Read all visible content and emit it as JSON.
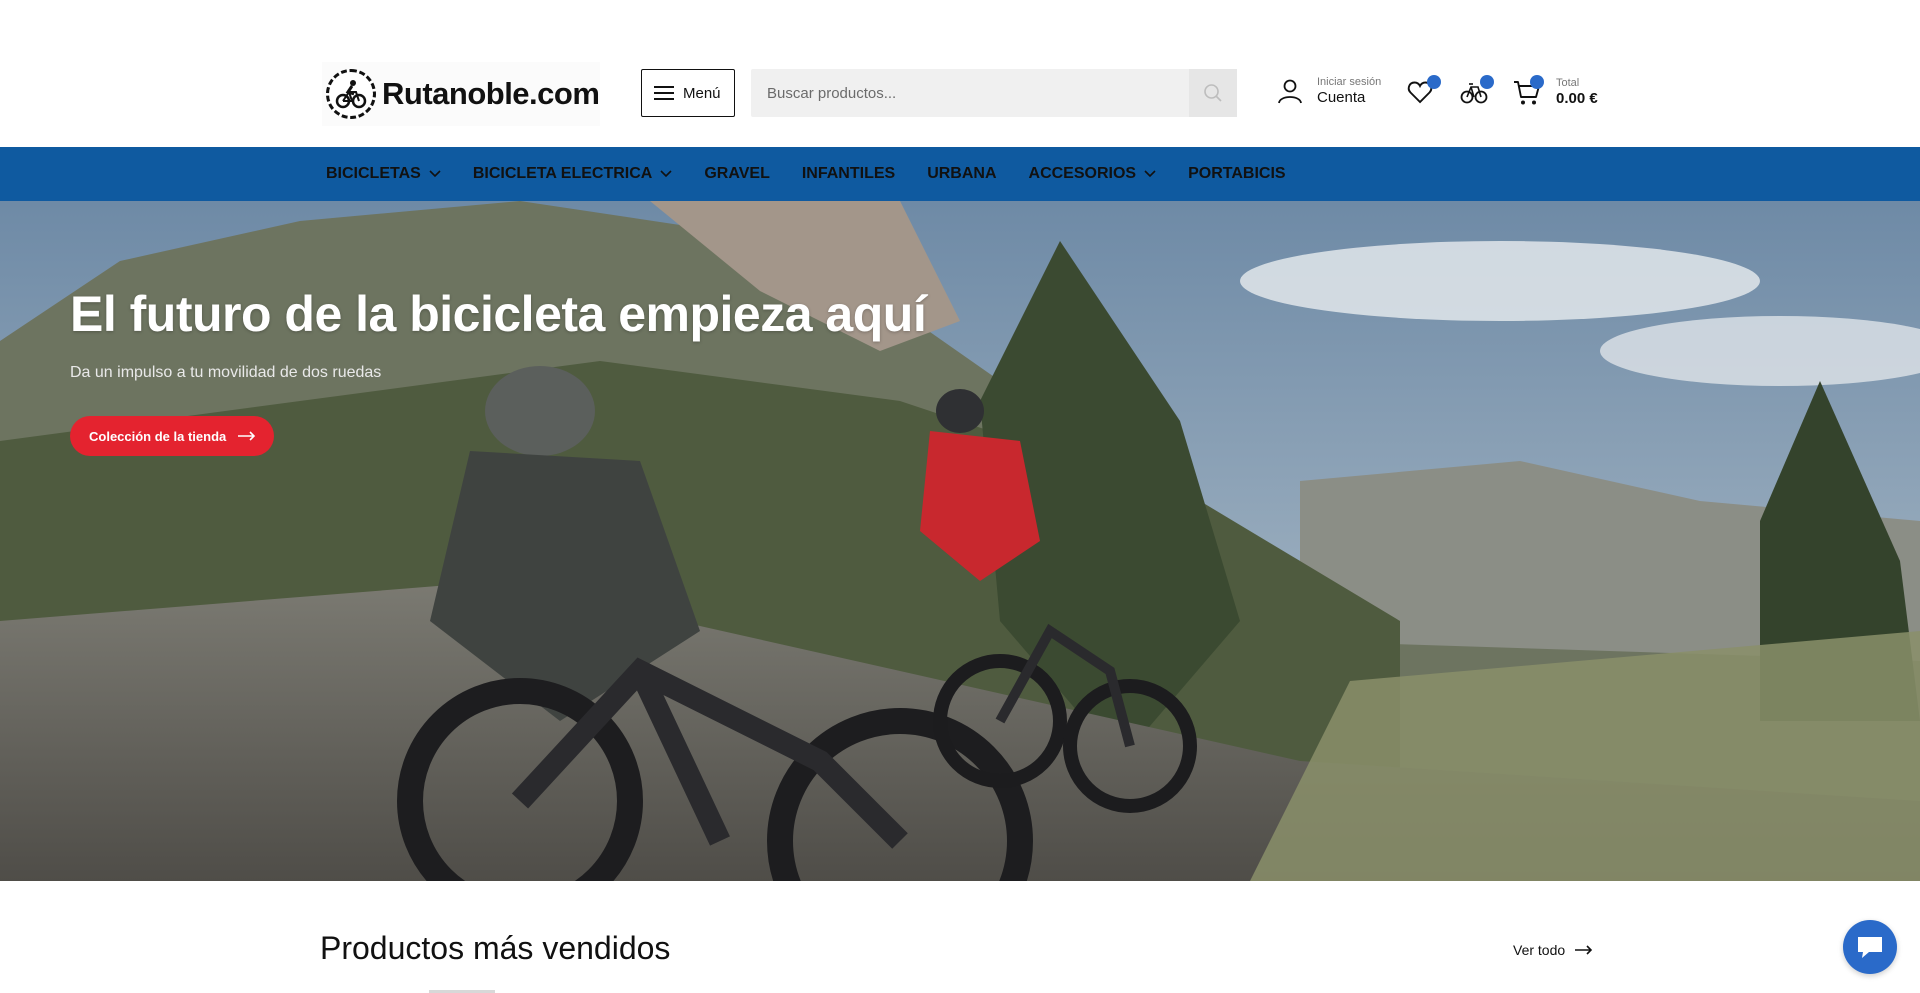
{
  "header": {
    "logo_text": "Rutanoble.com",
    "menu_label": "Menú",
    "search_placeholder": "Buscar productos...",
    "account_small": "Iniciar sesión",
    "account_big": "Cuenta",
    "total_small": "Total",
    "total_big": "0.00 €",
    "icons": [
      "user-icon",
      "heart-icon",
      "compare-icon",
      "cart-icon",
      "search-icon",
      "hamburger-icon"
    ]
  },
  "nav": {
    "items": [
      {
        "label": "BICICLETAS",
        "dropdown": true
      },
      {
        "label": "BICICLETA ELECTRICA",
        "dropdown": true
      },
      {
        "label": "GRAVEL",
        "dropdown": false
      },
      {
        "label": "INFANTILES",
        "dropdown": false
      },
      {
        "label": "URBANA",
        "dropdown": false
      },
      {
        "label": "ACCESORIOS",
        "dropdown": true
      },
      {
        "label": "PORTABICIS",
        "dropdown": false
      }
    ]
  },
  "hero": {
    "title": "El futuro de la bicicleta empieza aquí",
    "subtitle": "Da un impulso a tu movilidad de dos ruedas",
    "cta_label": "Colección de la tienda"
  },
  "bestsellers": {
    "title": "Productos más vendidos",
    "view_all": "Ver todo"
  },
  "colors": {
    "nav_bg": "#0f5aa0",
    "accent_red": "#e4232f",
    "badge_blue": "#2a6ac9"
  }
}
